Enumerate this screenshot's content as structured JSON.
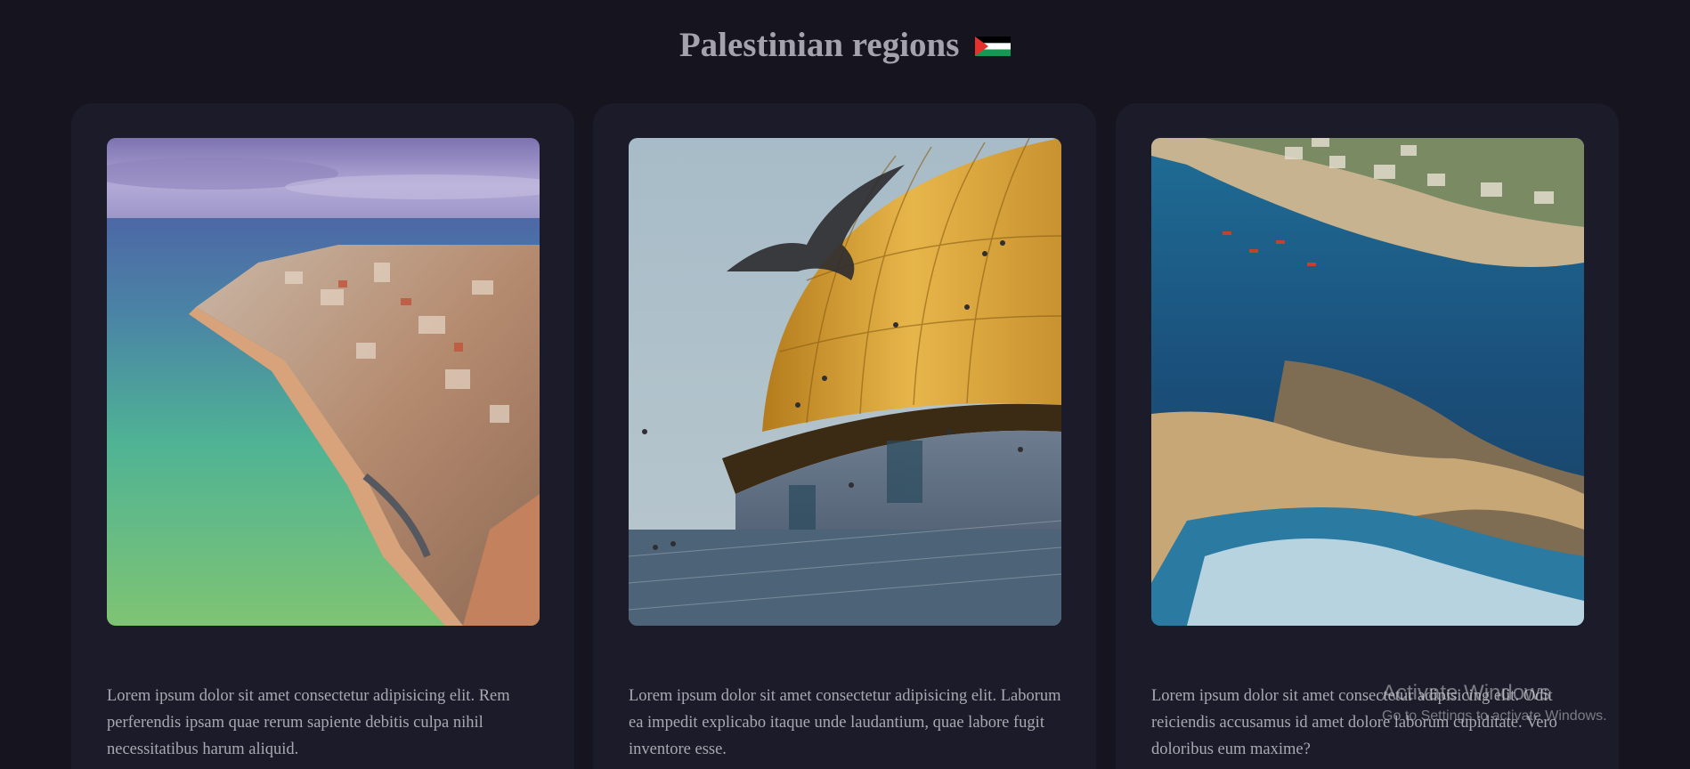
{
  "header": {
    "title": "Palestinian regions",
    "flag_icon": "palestine-flag-icon"
  },
  "colors": {
    "background": "#15141f",
    "card": "#1c1b29",
    "text": "#a9a8b1",
    "flag_black": "#000000",
    "flag_white": "#ffffff",
    "flag_green": "#149954",
    "flag_red": "#e4312b"
  },
  "cards": [
    {
      "image": "coastal-old-city-aerial-photo",
      "text": "Lorem ipsum dolor sit amet consectetur adipisicing elit. Rem perferendis ipsam quae rerum sapiente debitis culpa nihil necessitatibus harum aliquid."
    },
    {
      "image": "golden-dome-with-birds-photo",
      "text": "Lorem ipsum dolor sit amet consectetur adipisicing elit. Laborum ea impedit explicabo itaque unde laudantium, quae labore fugit inventore esse."
    },
    {
      "image": "sea-coast-aerial-photo",
      "text": "Lorem ipsum dolor sit amet consectetur adipisicing elit. Odit reiciendis accusamus id amet dolore laborum cupiditate. Vero doloribus eum maxime?"
    }
  ],
  "watermark": {
    "title": "Activate Windows",
    "subtitle": "Go to Settings to activate Windows."
  }
}
